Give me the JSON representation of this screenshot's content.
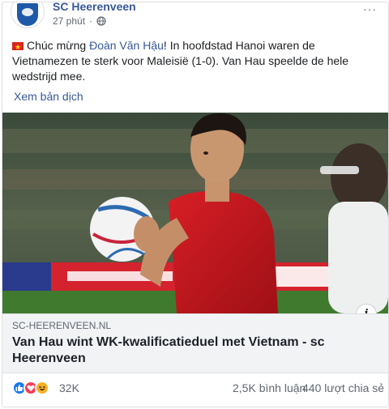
{
  "post": {
    "page_name": "SC Heerenveen",
    "time": "27 phút",
    "separator": "·",
    "more": "···",
    "text_prefix": "Chúc mừng ",
    "mention": "Đoàn Văn Hậu",
    "text_suffix": "! In hoofdstad Hanoi waren de Vietnamezen te sterk voor Maleisië (1-0). Van Hau speelde de hele wedstrijd mee.",
    "see_translation": "Xem bản dịch"
  },
  "link": {
    "domain": "SC-HEERENVEEN.NL",
    "title": "Van Hau wint WK-kwalificatieduel met Vietnam - sc Heerenveen",
    "info": "i"
  },
  "reactions": {
    "count": "32K",
    "comments": "2,5K bình luận",
    "shares": "440 lượt chia sẻ",
    "types": [
      "like-icon",
      "love-icon",
      "haha-icon"
    ]
  },
  "colors": {
    "link_blue": "#385898",
    "like": "#1877f2",
    "love": "#f33e58",
    "haha": "#f7b125",
    "jersey": "#c8161d"
  }
}
